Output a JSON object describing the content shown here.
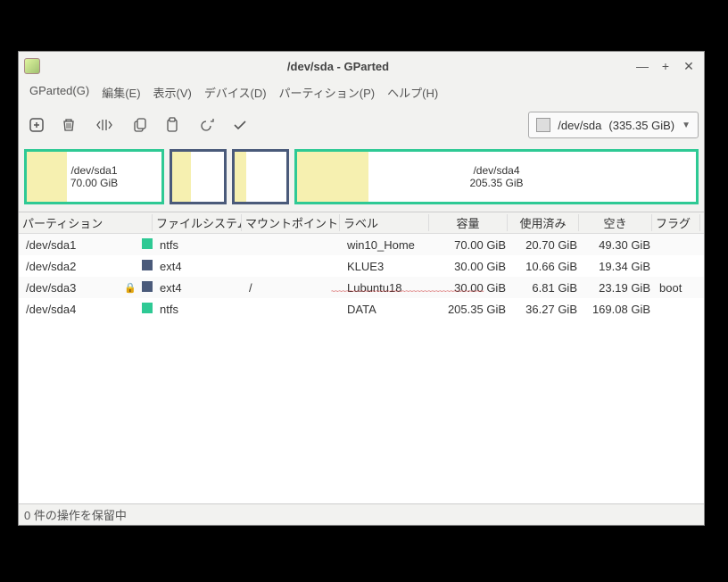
{
  "window": {
    "title": "/dev/sda - GParted",
    "minimize": "—",
    "maximize": "+",
    "close": "✕"
  },
  "menu": {
    "gparted": "GParted(G)",
    "edit": "編集(E)",
    "view": "表示(V)",
    "device": "デバイス(D)",
    "partition": "パーティション(P)",
    "help": "ヘルプ(H)"
  },
  "device_selector": {
    "device": "/dev/sda",
    "size": "(335.35 GiB)"
  },
  "diskmap": {
    "b1": {
      "label1": "/dev/sda1",
      "label2": "70.00 GiB"
    },
    "b4": {
      "label1": "/dev/sda4",
      "label2": "205.35 GiB"
    }
  },
  "columns": {
    "partition": "パーティション",
    "filesystem": "ファイルシステム",
    "mount": "マウントポイント",
    "label": "ラベル",
    "size": "容量",
    "used": "使用済み",
    "free": "空き",
    "flags": "フラグ"
  },
  "rows": [
    {
      "part": "/dev/sda1",
      "lock": "",
      "color": "#2ec994",
      "fs": "ntfs",
      "mount": "",
      "label": "win10_Home",
      "size": "70.00 GiB",
      "used": "20.70 GiB",
      "free": "49.30 GiB",
      "flags": ""
    },
    {
      "part": "/dev/sda2",
      "lock": "",
      "color": "#4a5a7a",
      "fs": "ext4",
      "mount": "",
      "label": "KLUE3",
      "size": "30.00 GiB",
      "used": "10.66 GiB",
      "free": "19.34 GiB",
      "flags": ""
    },
    {
      "part": "/dev/sda3",
      "lock": "🔒",
      "color": "#4a5a7a",
      "fs": "ext4",
      "mount": "/",
      "label": "Lubuntu18",
      "size": "30.00 GiB",
      "used": "6.81 GiB",
      "free": "23.19 GiB",
      "flags": "boot"
    },
    {
      "part": "/dev/sda4",
      "lock": "",
      "color": "#2ec994",
      "fs": "ntfs",
      "mount": "",
      "label": "DATA",
      "size": "205.35 GiB",
      "used": "36.27 GiB",
      "free": "169.08 GiB",
      "flags": ""
    }
  ],
  "status": "0 件の操作を保留中"
}
